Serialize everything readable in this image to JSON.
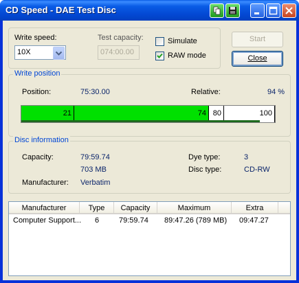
{
  "window": {
    "title": "CD Speed - DAE Test Disc"
  },
  "settings": {
    "write_speed_label": "Write speed:",
    "write_speed_value": "10X",
    "test_capacity_label": "Test capacity:",
    "test_capacity_value": "074:00.00",
    "simulate_label": "Simulate",
    "simulate_checked": false,
    "raw_mode_label": "RAW mode",
    "raw_mode_checked": true,
    "start_label": "Start",
    "close_label": "Close"
  },
  "write_position": {
    "legend": "Write position",
    "position_label": "Position:",
    "position_value": "75:30.00",
    "relative_label": "Relative:",
    "relative_value": "94 %",
    "bar": {
      "segments": [
        {
          "start": 0,
          "end": 21,
          "label": "21",
          "color": "#00E000"
        },
        {
          "start": 21,
          "end": 74,
          "label": "74",
          "color": "#00E000"
        },
        {
          "start": 74,
          "end": 80,
          "label": "80",
          "color": "#FFFFFF"
        },
        {
          "start": 80,
          "end": 100,
          "label": "100",
          "color": "#FFFFFF"
        }
      ],
      "progress_percent": 94
    }
  },
  "disc_info": {
    "legend": "Disc information",
    "capacity_label": "Capacity:",
    "capacity_time": "79:59.74",
    "capacity_size": "703 MB",
    "manufacturer_label": "Manufacturer:",
    "manufacturer_value": "Verbatim",
    "dye_type_label": "Dye type:",
    "dye_type_value": "3",
    "disc_type_label": "Disc type:",
    "disc_type_value": "CD-RW"
  },
  "table": {
    "columns": [
      "Manufacturer",
      "Type",
      "Capacity",
      "Maximum",
      "Extra"
    ],
    "rows": [
      [
        "Computer Support...",
        "6",
        "79:59.74",
        "89:47.26 (789 MB)",
        "09:47.27"
      ]
    ]
  },
  "colors": {
    "accent": "#0046D5",
    "bar_fill": "#00E000",
    "titlebar": "#0A5CE6"
  }
}
